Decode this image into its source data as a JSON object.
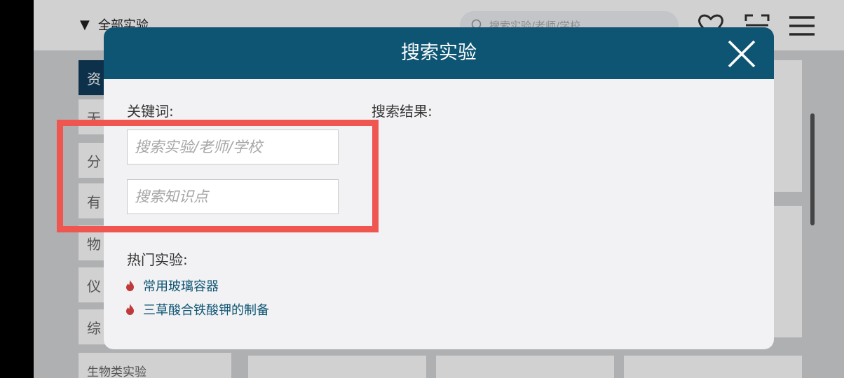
{
  "background": {
    "dropdown_label": "全部实验",
    "search_placeholder": "搜索实验/老师/学校",
    "sidebar": [
      "资",
      "无",
      "分",
      "有",
      "物",
      "仪",
      "综",
      "生物类实验"
    ],
    "card_tag": "资源",
    "icons": [
      "heart-icon",
      "scan-icon",
      "menu-icon",
      "star-icon"
    ]
  },
  "modal": {
    "title": "搜索实验",
    "keyword_label": "关键词:",
    "results_label": "搜索结果:",
    "search_experiment_placeholder": "搜索实验/老师/学校",
    "search_knowledge_placeholder": "搜索知识点",
    "hot_label": "热门实验:",
    "hot_items": [
      "常用玻璃容器",
      "三草酸合铁酸钾的制备"
    ]
  },
  "colors": {
    "header": "#0e5573",
    "highlight": "#f05650",
    "hot_link": "#0e5573",
    "flame": "#c0393b"
  }
}
